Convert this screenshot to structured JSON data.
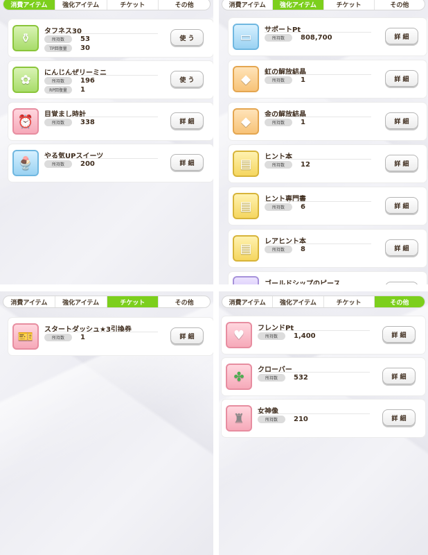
{
  "tabs": [
    "消費アイテム",
    "強化アイテム",
    "チケット",
    "その他"
  ],
  "labels": {
    "owned": "所持数",
    "tp": "TP回復量",
    "rp": "RP回復量"
  },
  "buttons": {
    "use": "使 う",
    "detail": "詳 細"
  },
  "panel1": {
    "active_tab": 0,
    "items": [
      {
        "name": "タフネス30",
        "owned": "53",
        "extra_label": "TP回復量",
        "extra": "30",
        "button": "使 う",
        "icon": "drink-bottle-icon"
      },
      {
        "name": "にんじんぜリーミニ",
        "owned": "196",
        "extra_label": "RP回復量",
        "extra": "1",
        "button": "使 う",
        "icon": "carrot-jelly-icon"
      },
      {
        "name": "目覚まし時計",
        "owned": "338",
        "button": "詳 細",
        "icon": "alarm-clock-icon"
      },
      {
        "name": "やる気UPスイーツ",
        "owned": "200",
        "button": "詳 細",
        "icon": "parfait-icon"
      }
    ]
  },
  "panel2": {
    "active_tab": 1,
    "items": [
      {
        "name": "サポートPt",
        "owned": "808,700",
        "button": "詳 細",
        "icon": "support-card-icon"
      },
      {
        "name": "虹の解放結晶",
        "owned": "1",
        "button": "詳 細",
        "icon": "rainbow-crystal-icon"
      },
      {
        "name": "金の解放結晶",
        "owned": "1",
        "button": "詳 細",
        "icon": "gold-crystal-icon"
      },
      {
        "name": "ヒント本",
        "owned": "12",
        "button": "詳 細",
        "icon": "hint-book-icon"
      },
      {
        "name": "ヒント専門書",
        "owned": "6",
        "button": "詳 細",
        "icon": "hint-textbook-icon"
      },
      {
        "name": "レアヒント本",
        "owned": "8",
        "button": "詳 細",
        "icon": "rare-hint-book-icon"
      },
      {
        "name": "ゴールドシップのピース",
        "icon": "piece-icon"
      }
    ]
  },
  "panel3": {
    "active_tab": 2,
    "items": [
      {
        "name": "スタートダッシュ★3引換券",
        "owned": "1",
        "button": "詳 細",
        "icon": "ticket-icon"
      }
    ]
  },
  "panel4": {
    "active_tab": 3,
    "items": [
      {
        "name": "フレンドPt",
        "owned": "1,400",
        "button": "詳 細",
        "icon": "handshake-heart-icon"
      },
      {
        "name": "クローバー",
        "owned": "532",
        "button": "詳 細",
        "icon": "clover-icon"
      },
      {
        "name": "女神像",
        "owned": "210",
        "button": "詳 細",
        "icon": "goddess-statue-icon"
      }
    ]
  }
}
